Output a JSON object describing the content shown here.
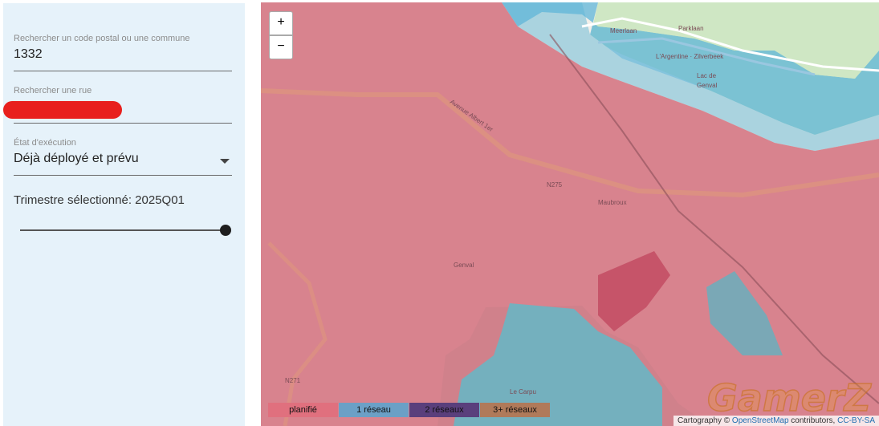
{
  "sidebar": {
    "postal": {
      "label": "Rechercher un code postal ou une commune",
      "value": "1332"
    },
    "street": {
      "label": "Rechercher une rue"
    },
    "execution": {
      "label": "État d'exécution",
      "value": "Déjà déployé et prévu"
    },
    "quarter": {
      "text": "Trimestre sélectionné: 2025Q01",
      "slider_fraction": 1.0
    }
  },
  "map": {
    "zoom_in": "+",
    "zoom_out": "−",
    "labels": {
      "genval": "Genval",
      "maubroux": "Maubroux",
      "lac": "Lac de",
      "lac2": "Genval",
      "argentine": "L'Argentine · Zilverbeek",
      "le_carpu": "Le Carpu",
      "parklaan": "Parklaan",
      "meerlaan": "Meerlaan",
      "n275": "N275",
      "n271": "N271",
      "albert": "Avenue Albert 1er"
    },
    "legend": [
      {
        "label": "planifié",
        "color": "#e0707e"
      },
      {
        "label": "1 réseau",
        "color": "#6ba0c6"
      },
      {
        "label": "2 réseaux",
        "color": "#5a3f7c"
      },
      {
        "label": "3+ réseaux",
        "color": "#b07a5a"
      }
    ],
    "attribution": {
      "prefix": "Cartography © ",
      "osm": "OpenStreetMap",
      "middle": " contributors, ",
      "license": "CC-BY-SA"
    },
    "watermark": "GamerZ"
  }
}
